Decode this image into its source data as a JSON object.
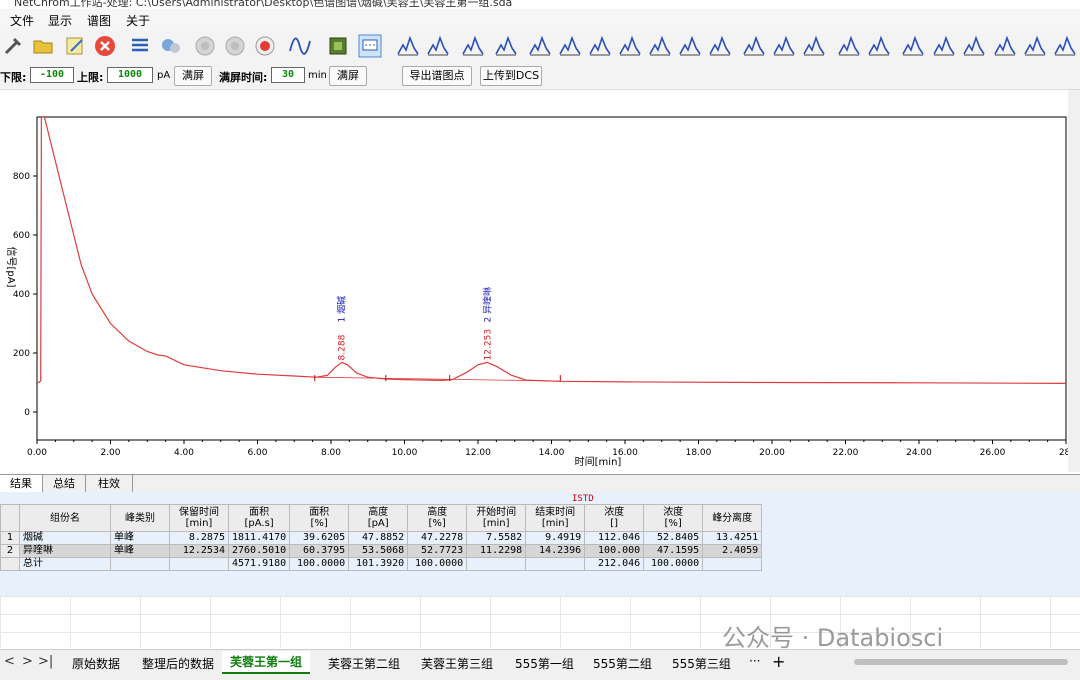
{
  "window": {
    "title": "NetChrom工作站-处理: C:\\Users\\Administrator\\Desktop\\色谱图谱\\烟碱\\芙蓉王\\芙蓉王第一组.sda"
  },
  "menu": [
    "文件",
    "显示",
    "谱图",
    "关于"
  ],
  "toolbar": {
    "icons": [
      "tools-icon",
      "open-folder-icon",
      "edit-icon",
      "close-icon",
      "list-icon",
      "network-icon",
      "disabled-circle-icon",
      "disabled-circle-icon",
      "record-icon",
      "peak-wave-icon",
      "green-square-icon",
      "chat-icon",
      "peak-tool-icon",
      "peak-tool-icon",
      "peak-tool-icon",
      "peak-tool-icon",
      "peak-tool-icon",
      "peak-tool-icon",
      "peak-tool-icon",
      "peak-tool-icon",
      "peak-tool-icon",
      "peak-tool-icon",
      "peak-tool-icon",
      "peak-tool-icon",
      "peak-tool-icon",
      "peak-tool-icon",
      "peak-tool-icon",
      "peak-tool-icon",
      "peak-tool-icon",
      "peak-tool-icon",
      "peak-tool-icon",
      "peak-tool-icon",
      "peak-tool-icon",
      "peak-tool-icon",
      "peak-tool-icon"
    ]
  },
  "params": {
    "lower_label": "下限:",
    "lower_value": "-100",
    "upper_label": "上限:",
    "upper_value": "1000",
    "upper_unit": "pA",
    "fullscreen1": "满屏",
    "time_label": "满屏时间:",
    "time_value": "30",
    "time_unit": "min",
    "fullscreen2": "满屏",
    "export_btn": "导出谱图点",
    "upload_btn": "上传到DCS"
  },
  "chart_data": {
    "type": "line",
    "xlabel": "时间[min]",
    "ylabel": "信号[pA]",
    "xlim": [
      0,
      28
    ],
    "ylim": [
      -100,
      1000
    ],
    "x_ticks": [
      "0.00",
      "2.00",
      "4.00",
      "6.00",
      "8.00",
      "10.00",
      "12.00",
      "14.00",
      "16.00",
      "18.00",
      "20.00",
      "22.00",
      "24.00",
      "26.00",
      "28."
    ],
    "y_ticks": [
      "0",
      "200",
      "400",
      "600",
      "800"
    ],
    "series": [
      {
        "color": "#e03c3c",
        "x": [
          0.0,
          0.05,
          0.1,
          0.12,
          0.15,
          0.2,
          0.8,
          1.2,
          1.5,
          2.0,
          2.5,
          3.0,
          3.3,
          3.5,
          4.0,
          5.0,
          6.0,
          7.0,
          7.6,
          7.9,
          8.1,
          8.29,
          8.45,
          8.7,
          9.0,
          9.5,
          10.0,
          11.0,
          11.3,
          11.7,
          12.0,
          12.25,
          12.5,
          12.9,
          13.3,
          14.2,
          16.0,
          20.0,
          24.0,
          28.0
        ],
        "y": [
          100,
          100,
          105,
          1000,
          1000,
          1000,
          700,
          500,
          400,
          300,
          240,
          205,
          193,
          190,
          160,
          140,
          128,
          122,
          118,
          124,
          150,
          168,
          160,
          132,
          118,
          112,
          110,
          107,
          110,
          135,
          160,
          168,
          155,
          125,
          108,
          104,
          102,
          100,
          99,
          97
        ]
      }
    ],
    "peaks": [
      {
        "rt": "8.288",
        "num": "1",
        "name": "烟碱",
        "x": 8.288,
        "y": 168,
        "start": 7.5582,
        "end": 9.4919
      },
      {
        "rt": "12.253",
        "num": "2",
        "name": "异喹啉",
        "x": 12.253,
        "y": 168,
        "start": 11.2298,
        "end": 14.2396
      }
    ],
    "baseline_y": {
      "from": [
        7.5582,
        118
      ],
      "to": [
        14.2396,
        105
      ]
    }
  },
  "result_tabs": [
    "结果",
    "总结",
    "柱效"
  ],
  "istd": "ISTD",
  "table": {
    "headers": [
      [
        "组份名"
      ],
      [
        "峰类别"
      ],
      [
        "保留时间",
        "[min]"
      ],
      [
        "面积",
        "[pA.s]"
      ],
      [
        "面积",
        "[%]"
      ],
      [
        "高度",
        "[pA]"
      ],
      [
        "高度",
        "[%]"
      ],
      [
        "开始时间",
        "[min]"
      ],
      [
        "结束时间",
        "[min]"
      ],
      [
        "浓度",
        "[]"
      ],
      [
        "浓度",
        "[%]"
      ],
      [
        "峰分离度"
      ]
    ],
    "rows": [
      {
        "idx": "1",
        "cells": [
          "烟碱",
          "单峰",
          "8.2875",
          "1811.4170",
          "39.6205",
          "47.8852",
          "47.2278",
          "7.5582",
          "9.4919",
          "112.046",
          "52.8405",
          "13.4251"
        ]
      },
      {
        "idx": "2",
        "cells": [
          "异喹啉",
          "单峰",
          "12.2534",
          "2760.5010",
          "60.3795",
          "53.5068",
          "52.7723",
          "11.2298",
          "14.2396",
          "100.000",
          "47.1595",
          "2.4059"
        ]
      },
      {
        "idx": "",
        "cells": [
          "总计",
          "",
          "",
          "4571.9180",
          "100.0000",
          "101.3920",
          "100.0000",
          "",
          "",
          "212.046",
          "100.0000",
          ""
        ]
      }
    ]
  },
  "watermark": "公众号 · Databiosci",
  "sheets": {
    "nav": [
      "<",
      ">",
      ">|"
    ],
    "tabs": [
      "原始数据",
      "整理后的数据",
      "芙蓉王第一组",
      "芙蓉王第二组",
      "芙蓉王第三组",
      "555第一组",
      "555第二组",
      "555第三组"
    ],
    "active": 2,
    "more": "···",
    "add": "+"
  }
}
